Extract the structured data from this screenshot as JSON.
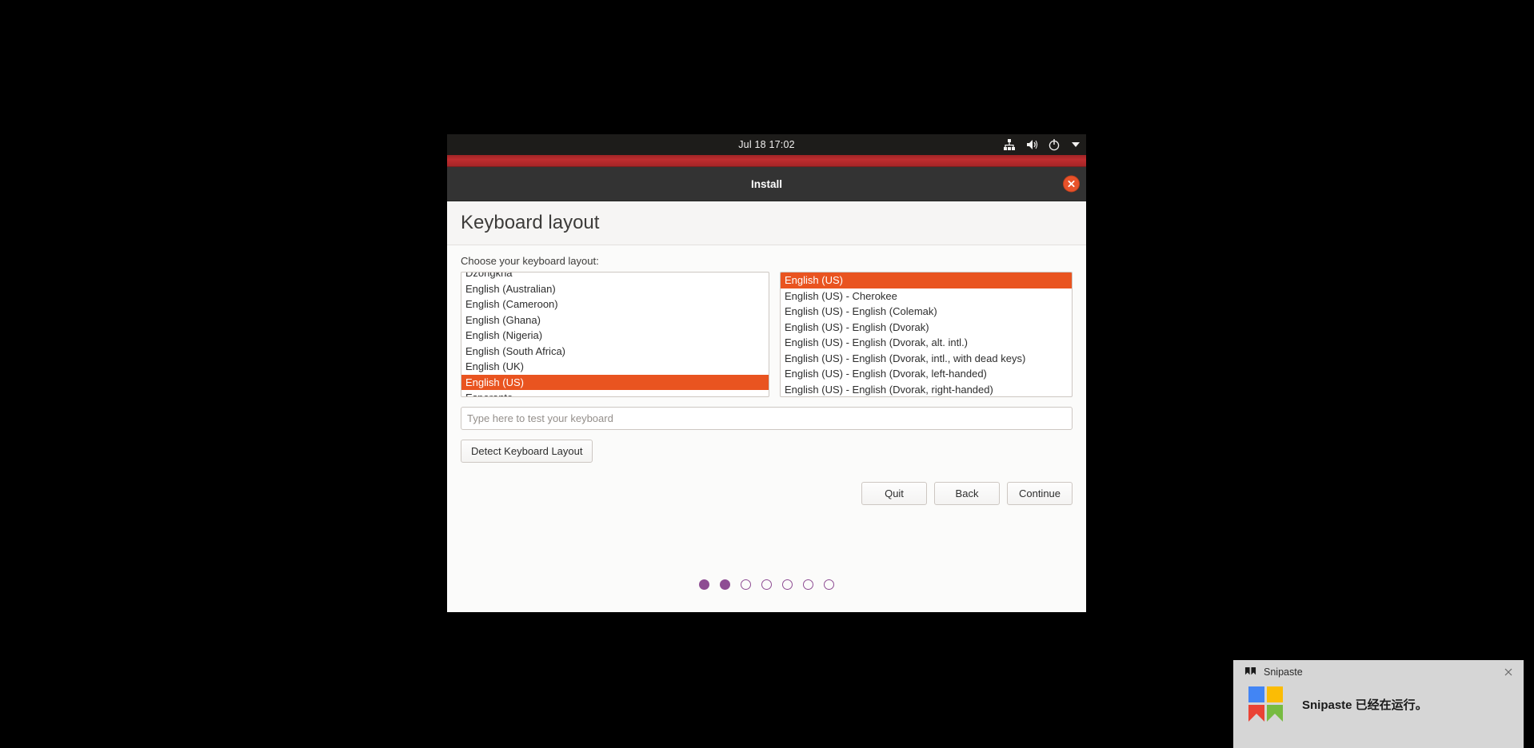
{
  "desktop": {
    "background_color": "#000000"
  },
  "system_bar": {
    "clock": "Jul 18  17:02",
    "tray_icons": [
      "network-icon",
      "volume-icon",
      "power-icon",
      "chevron-down-icon"
    ]
  },
  "window": {
    "title": "Install",
    "close_label": "Close",
    "accent_color": "#e95420",
    "titlebar_color": "#333333",
    "stripe_color": "#be2d2f"
  },
  "page": {
    "title": "Keyboard layout",
    "choose_label": "Choose your keyboard layout:"
  },
  "layout_list": {
    "items": [
      {
        "label": "Dzongkha",
        "selected": false,
        "clipped": true
      },
      {
        "label": "English (Australian)",
        "selected": false
      },
      {
        "label": "English (Cameroon)",
        "selected": false
      },
      {
        "label": "English (Ghana)",
        "selected": false
      },
      {
        "label": "English (Nigeria)",
        "selected": false
      },
      {
        "label": "English (South Africa)",
        "selected": false
      },
      {
        "label": "English (UK)",
        "selected": false
      },
      {
        "label": "English (US)",
        "selected": true
      },
      {
        "label": "Esperanto",
        "selected": false,
        "clipped": true
      }
    ]
  },
  "variant_list": {
    "items": [
      {
        "label": "English (US)",
        "selected": true
      },
      {
        "label": "English (US) - Cherokee",
        "selected": false
      },
      {
        "label": "English (US) - English (Colemak)",
        "selected": false
      },
      {
        "label": "English (US) - English (Dvorak)",
        "selected": false
      },
      {
        "label": "English (US) - English (Dvorak, alt. intl.)",
        "selected": false
      },
      {
        "label": "English (US) - English (Dvorak, intl., with dead keys)",
        "selected": false
      },
      {
        "label": "English (US) - English (Dvorak, left-handed)",
        "selected": false
      },
      {
        "label": "English (US) - English (Dvorak, right-handed)",
        "selected": false
      }
    ]
  },
  "test_field": {
    "placeholder": "Type here to test your keyboard",
    "value": ""
  },
  "detect_button": {
    "label": "Detect Keyboard Layout"
  },
  "nav_buttons": {
    "quit": "Quit",
    "back": "Back",
    "continue": "Continue"
  },
  "progress_dots": {
    "total": 7,
    "filled": 2,
    "color": "#8e4d93"
  },
  "snipaste_toast": {
    "app_name": "Snipaste",
    "message": "Snipaste 已经在运行。",
    "close_label": "×",
    "logo_colors": {
      "top_left": "#4285f4",
      "top_right": "#fbbc05",
      "bottom_left": "#ea4335",
      "bottom_right": "#77bb41"
    }
  }
}
